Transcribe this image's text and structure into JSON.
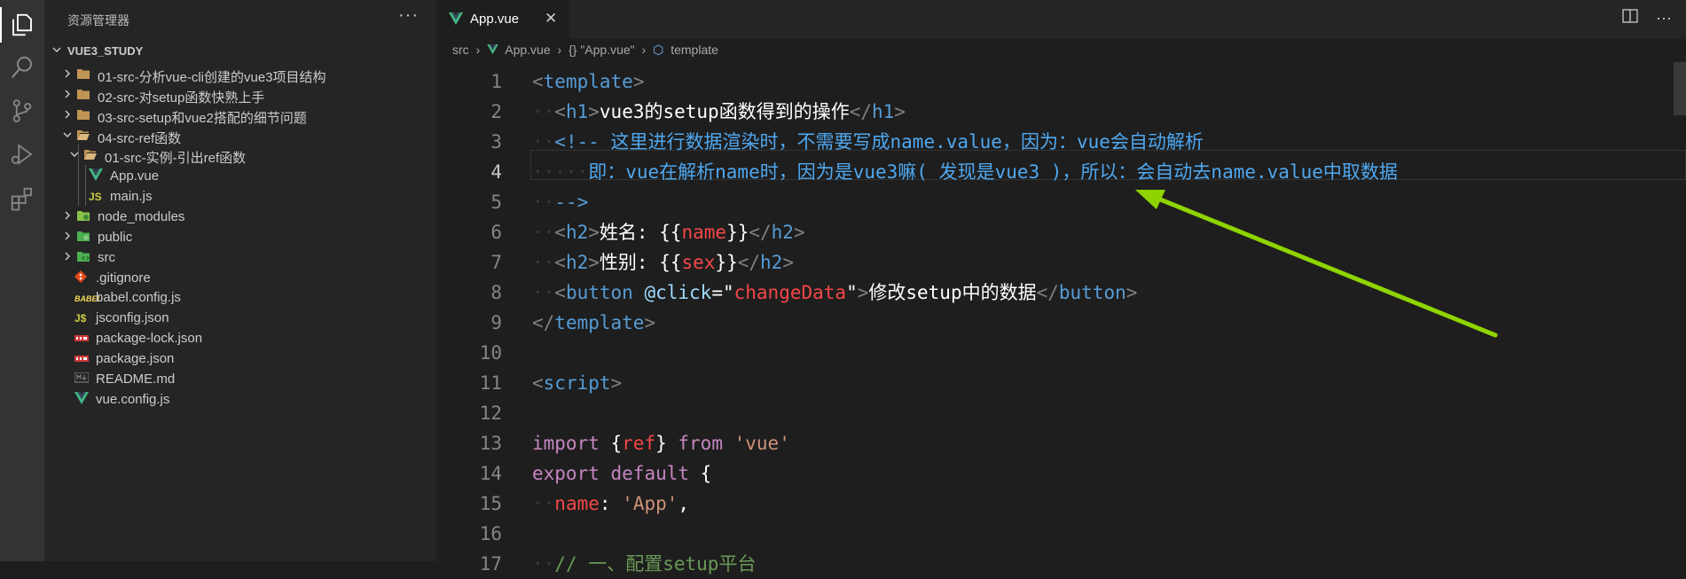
{
  "sidebar": {
    "title": "资源管理器",
    "more": "···",
    "section": "VUE3_STUDY",
    "items": [
      {
        "name": "01-src-分析vue-cli创建的vue3项目结构",
        "kind": "folder",
        "level": 0,
        "open": false
      },
      {
        "name": "02-src-对setup函数快熟上手",
        "kind": "folder",
        "level": 0,
        "open": false
      },
      {
        "name": "03-src-setup和vue2搭配的细节问题",
        "kind": "folder",
        "level": 0,
        "open": false
      },
      {
        "name": "04-src-ref函数",
        "kind": "folder",
        "level": 0,
        "open": true
      },
      {
        "name": "01-src-实例-引出ref函数",
        "kind": "folder",
        "level": 1,
        "open": true
      },
      {
        "name": "App.vue",
        "kind": "vue",
        "level": 2
      },
      {
        "name": "main.js",
        "kind": "js",
        "level": 2
      },
      {
        "name": "node_modules",
        "kind": "node",
        "level": 0,
        "open": false
      },
      {
        "name": "public",
        "kind": "public",
        "level": 0,
        "open": false
      },
      {
        "name": "src",
        "kind": "src",
        "level": 0,
        "open": false
      },
      {
        "name": ".gitignore",
        "kind": "git",
        "level": 0
      },
      {
        "name": "babel.config.js",
        "kind": "babel",
        "level": 0
      },
      {
        "name": "jsconfig.json",
        "kind": "jsconfig",
        "level": 0
      },
      {
        "name": "package-lock.json",
        "kind": "npm",
        "level": 0
      },
      {
        "name": "package.json",
        "kind": "npm",
        "level": 0
      },
      {
        "name": "README.md",
        "kind": "md",
        "level": 0
      },
      {
        "name": "vue.config.js",
        "kind": "vue",
        "level": 0
      }
    ]
  },
  "tab": {
    "label": "App.vue",
    "close": "✕"
  },
  "breadcrumb": {
    "p1": "src",
    "p2": "App.vue",
    "p3": "{} \"App.vue\"",
    "p4": "template"
  },
  "icon_names": [
    "explorer-icon",
    "search-icon",
    "source-control-icon",
    "run-debug-icon",
    "extensions-icon"
  ],
  "colors": {
    "accent": "#569cd6",
    "red": "#f44747",
    "comment": "#4fa8f0",
    "arrow": "#8fd400"
  },
  "editor": {
    "active_line": 4,
    "lines": [
      [
        [
          "tg",
          "<"
        ],
        [
          "tn",
          "template"
        ],
        [
          "tg",
          ">"
        ]
      ],
      [
        [
          "ws",
          "··"
        ],
        [
          "tg",
          "<"
        ],
        [
          "tn",
          "h1"
        ],
        [
          "tg",
          ">"
        ],
        [
          "wt",
          "vue3的setup函数得到的操作"
        ],
        [
          "tg",
          "</"
        ],
        [
          "tn",
          "h1"
        ],
        [
          "tg",
          ">"
        ]
      ],
      [
        [
          "ws",
          "··"
        ],
        [
          "tn",
          "<!--"
        ],
        [
          "cb",
          " 这里进行数据渲染时，不需要写成name.value，因为：vue会自动解析"
        ]
      ],
      [
        [
          "ws",
          "·····"
        ],
        [
          "cb",
          "即：vue在解析name时，因为是vue3嘛( 发现是vue3 )，所以：会自动去name.value中取数据"
        ]
      ],
      [
        [
          "ws",
          "··"
        ],
        [
          "tn",
          "-->"
        ]
      ],
      [
        [
          "ws",
          "··"
        ],
        [
          "tg",
          "<"
        ],
        [
          "tn",
          "h2"
        ],
        [
          "tg",
          ">"
        ],
        [
          "wt",
          "姓名: {{"
        ],
        [
          "rd",
          "name"
        ],
        [
          "wt",
          "}}"
        ],
        [
          "tg",
          "</"
        ],
        [
          "tn",
          "h2"
        ],
        [
          "tg",
          ">"
        ]
      ],
      [
        [
          "ws",
          "··"
        ],
        [
          "tg",
          "<"
        ],
        [
          "tn",
          "h2"
        ],
        [
          "tg",
          ">"
        ],
        [
          "wt",
          "性别: {{"
        ],
        [
          "rd",
          "sex"
        ],
        [
          "wt",
          "}}"
        ],
        [
          "tg",
          "</"
        ],
        [
          "tn",
          "h2"
        ],
        [
          "tg",
          ">"
        ]
      ],
      [
        [
          "ws",
          "··"
        ],
        [
          "tg",
          "<"
        ],
        [
          "tn",
          "button"
        ],
        [
          "wt",
          " "
        ],
        [
          "at",
          "@click"
        ],
        [
          "wt",
          "=\""
        ],
        [
          "rd",
          "changeData"
        ],
        [
          "wt",
          "\""
        ],
        [
          "tg",
          ">"
        ],
        [
          "wt",
          "修改setup中的数据"
        ],
        [
          "tg",
          "</"
        ],
        [
          "tn",
          "button"
        ],
        [
          "tg",
          ">"
        ]
      ],
      [
        [
          "tg",
          "</"
        ],
        [
          "tn",
          "template"
        ],
        [
          "tg",
          ">"
        ]
      ],
      [],
      [
        [
          "tg",
          "<"
        ],
        [
          "tn",
          "script"
        ],
        [
          "tg",
          ">"
        ]
      ],
      [],
      [
        [
          "kc",
          "import"
        ],
        [
          "wt",
          " {"
        ],
        [
          "rd",
          "ref"
        ],
        [
          "wt",
          "} "
        ],
        [
          "kc",
          "from"
        ],
        [
          "wt",
          " "
        ],
        [
          "st",
          "'vue'"
        ]
      ],
      [
        [
          "kc",
          "export"
        ],
        [
          "wt",
          " "
        ],
        [
          "kc",
          "default"
        ],
        [
          "wt",
          " {"
        ]
      ],
      [
        [
          "ws",
          "··"
        ],
        [
          "rd",
          "name"
        ],
        [
          "wt",
          ": "
        ],
        [
          "st",
          "'App'"
        ],
        [
          "wt",
          ","
        ]
      ],
      [],
      [
        [
          "ws",
          "··"
        ],
        [
          "cm",
          "// 一、配置setup平台"
        ]
      ]
    ]
  }
}
